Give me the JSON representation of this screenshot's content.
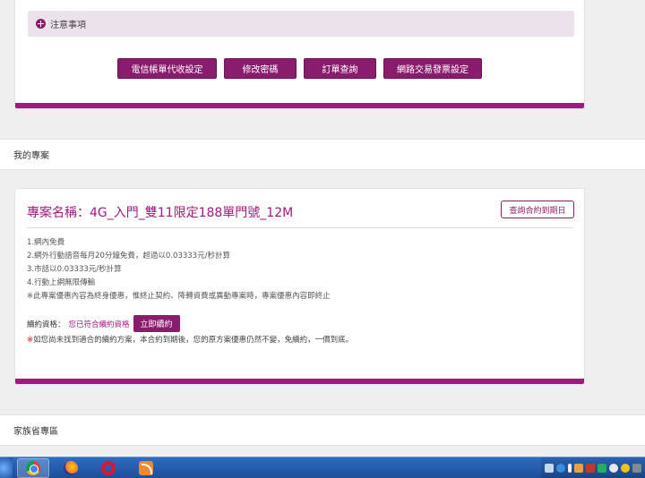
{
  "top_card": {
    "notice_label": "注意事項",
    "buttons": [
      {
        "label": "電信帳單代收設定"
      },
      {
        "label": "修改密碼"
      },
      {
        "label": "訂單查詢"
      },
      {
        "label": "網路交易發票設定"
      }
    ]
  },
  "sections": {
    "my_projects": "我的專案",
    "family": "家族省專區"
  },
  "project": {
    "title": "專案名稱：4G_入門_雙11限定188單門號_12M",
    "query_button": "查詢合約到期日",
    "terms": [
      "1.網內免費",
      "2.網外行動語音每月20分鐘免費，超過以0.03333元/秒計算",
      "3.市話以0.03333元/秒計算",
      "4.行動上網無限傳輸",
      "※此專案優惠內容為終身優惠，惟終止契約、降轉資費或異動專案時，專案優惠內容即終止"
    ],
    "renew_label": "續約資格：",
    "renew_status": "您已符合續約資格",
    "renew_button": "立即續約",
    "renew_note_star": "※",
    "renew_note": "如您尚未找到適合的續約方案，本合約到期後，您的原方案優惠仍然不變，免續約，一價到底。"
  },
  "taskbar": {
    "apps": [
      "chrome-icon",
      "firefox-icon",
      "opera-icon",
      "feed-icon"
    ]
  },
  "colors": {
    "accent": "#8a1c6e",
    "accent_bar": "#a0197f",
    "notice_bg": "#ece2ec"
  }
}
